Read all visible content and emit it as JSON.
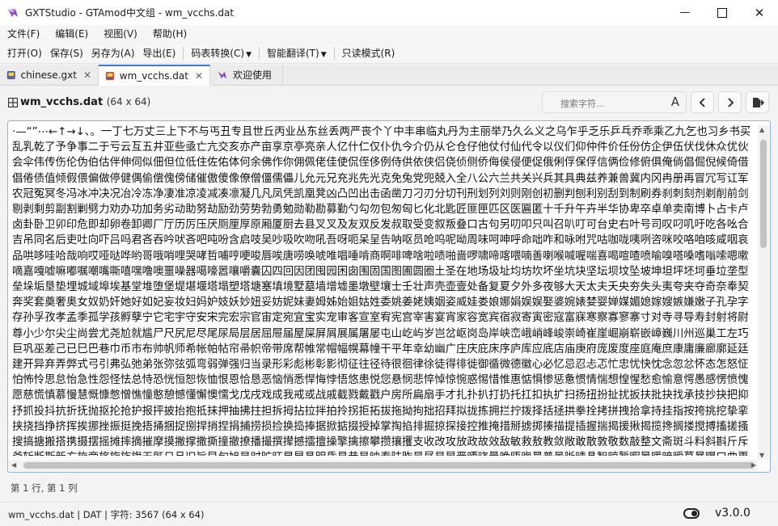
{
  "window": {
    "title": "GXTStudio - GTAmod中文组 - wm_vcchs.dat",
    "minimize_glyph": "—",
    "maximize_glyph": "☐",
    "close_glyph": "✕"
  },
  "menu": [
    "文件(F)",
    "编辑(E)",
    "视图(V)",
    "帮助(H)"
  ],
  "toolbar": {
    "open": "打开(O)",
    "save": "保存(S)",
    "save_as": "另存为(A)",
    "export": "导出(E)",
    "encoding": "码表转换(C)",
    "smart_translate": "智能翻译(T)",
    "readonly": "只读模式(R)"
  },
  "tabs": [
    {
      "label": "chinese.gxt",
      "close": "✕"
    },
    {
      "label": "wm_vcchs.dat",
      "close": "✕"
    },
    {
      "label": "欢迎使用"
    }
  ],
  "file_header": {
    "name": "wm_vcchs.dat",
    "dims": "(64 x 64)"
  },
  "search": {
    "placeholder": "搜索字符...",
    "case_label": "A"
  },
  "editor_text": "·—“”⋯←↑→↓、。一丁七万丈三上下不与丐丑专且世丘丙业丛东丝丢两严丧个丫中丰串临丸丹为主丽举乃久么义之乌乍乎乏乐乒乓乔乖乘乙九乞也习乡书买乱乳乾了予争事二于亏云互五井亚些亟亡亢交亥亦产亩享京亭亮亲人亿什仁仅仆仇今介仍从仑仓仔他仗付仙代令以仪们仰仲件价任份仿企伊伍伏伐休众优伙会伞伟传伤伦伪伯估伴伸伺似佃但位低住佐佑体何余佛作你佣佩佬佳使侃侄侈例侍供依侠侣侥侦侧侨侮侯侵便促俄俐俘保俘信俩俭修俯俱俺倘倡倔倪候倚借倡倦债值倾假偎偏做停健偶偷偿傀傍储催傲傻像僚僧僵儒儡儿允元兄充兆先光克免兔党兜兢入全八公六兰共关兴兵其具典兹养兼兽冀内冈冉册再冒冗写讧军农冠冤冥冬冯冰冲决况冶冷冻净凄准凉凌减凑凛凝几凡凤凭凯凰凳凶凸凹出击函凿刀刁刃分切刊刑划列刘则刚创初删判刨利别刮到制刷券刹刺刻剂剃削前剑剔剥剩剪副割剿劈力劝办功加务劣动助努劫励劲劳势勃勇勉勋勒勘募勤勺勾勿包匆匈匕化北匙匠匪匣匹区医匾匿十千升午卉半华协卑卒卓单卖南博卜占卡卢卤卦卧卫卯印危即却卵卷卸卿厂厅历厉压厌厕厘厚原厢厦厨去县叉叉及友双反发叔取受变叙叛叠口古句另叨叩只叫召叭叮可台史右叶号司叹叼叽吁吃各吆合吉吊同名后吏吐向吓吕吗君吝吞吟吠吝吧吨吩含启吱吴吵吸吹吻吼吾呀呃呆呈告呐呕员呛呜呢呦周味呵呻呼命咄咋和咏咐咒咕咖咙咦咧咨咪咬咯咱咳咸咽哀品哄哆哇哈哉响哎哑哒哗哟哥哦哨哩哭哮哲哺哼哽唆唇唉唐唠唤唬唯唱唾啃商啊啡啤啥啦啧啪啬啰啸啼喀喂喃善喇喉喊喔喘喜喝喧喳喷喻嗅嗒嗓嗜嗡嗦嗯嗽嘀嘉嘎嘘嘛嘟嘱嘲嘴嘶嘻嘿噜噢噩噪器噶嚎嚣嚷嚼囊囚四回因团囤园困囱围固国图圃圆圈土圣在地场圾址均坊坎坏坐坑块坚坛坝坟坠坡坤坦坪坯坷垂垃垄型垒垛垢垦垫埋城域埠埃基堂堆堕堡堤堪堰塔塌塑塔塘塞填境墅墓墙增墟墨墩壁壤士壬壮声壳壶壹处备复夏夕外多夜够大天太夫夭央夯失头夷夸夹夺奇奈奉契奔奖套奠奢奥女奴奶奸她好如妃妄妆妇妈妒妓妖妙妞妥妨妮妹妻姆姊始姐姑姓委姚姜姥姨姻姿威娃娄娘娜娟娱娱娶婆婉婊婪婴婵媒媚媳嫁嫂嫉嫌嫩子孔孕字存孙孚孜孝孟季孤学孩孵孽宁它宅宇守安宋完宏宗官宙定宛宜宝实宠审客宣室宥宪宫宰害宴宵家容宽宾宿寂寄寅密寇富寐寒察寡寥寨寸对寺寻导寿封射将尉尊小少尔尖尘尚尝尤尧尬就尴尸尺尻尼尽尾尿局层居屈屉届屋屎屏屑展属屠屡屯山屹屿岁岂岔岖岗岛岸峡峦峨峭峰峻崇崎崔崖崛崩崭嵌嶂巍川州巡巢工左巧巨巩巫差己已巳巴巷巾币市布帅帆师希帐帕帖帘帚帜帝带席帮帷常帽幅幌幕幢干平年幸幼幽广庄庆庇床序庐库应底店庙庚府庞废度座庭庵庶康庸廉廊廓延廷建开异弃弄弊式弓引弗弘弛弟张弥弦弧弯弱弹强归当录形彩彪彬彰影彻征往径待很徊律徐徒得徘徙御循微德徽心必忆忌忍忐忑忙忠忧快忱念忽忿怀态怎怒怔怕怖怜思怠怡急性怨怪怯总恃恐恍恒恕恢恤恨恩恰恳恶恼悄悉悍悔悖悟悠患悦您悬悯悲悴悼惊惋惑惕惜惟惠惦惧惨惩惫惯情惴想惶惺愁愈愉意愕愚感愣愤愧愿慈慌慎慕慢慧慨慷憋憎憔憧憨憩憾懂懈懊懦戈戊戌戏成我戒或战戚截戮戴戳户房所扁扇手才扎扑扒打扔托扛扣执扩扫扬扭扮扯扰扳扶批抉找承技抄抉把抑抒抓投抖抗折抚抛抠抡抢护报抨披抬抱抵抹押抽拂拄担拆拇拈拉拌拍拎拐拒拓拔拖拗拘拙招拜拟拢拣拥拦拧拨择括拯拱拳拴拷拼拽拾拿持挂指按挎挑挖挚挛挟挠挡挣挤挥挨挪挫振挺挽捂捅捆捉捌捍捎捏捐捕捞损捡换捣捧据掀掂掇授掉掌掏掐排掘掠探接控推掩措掰掳掷揍描提插握揣揭援揪揭揽搀搁搂搅搏搐搓搔搜搞搪搬搭携摄摆摇摊摔摘摧摩摸撇撑撒撕撞撤撩播撮撰撵撼擂擅操擎擒擦攀攒攘攫支收改攻放政故效敌敏救敖教敛敞敢散敦敬数敲整文斋斑斗料斜斟斤斥斧斩断斯新方施旁旅旋族旗无既日旦旧旨早旬旭旱时旷旺昂昆昌明昏易昔星映春昧昨是昼显晃晋晒晓晕晚晤晦晨普景晰晴晶智晾暂暇暑暖暗暧暮暴曝曰曲更曹曼曾替最月有朋服朗望朝期朦木未末本术朱朴朵机杀杂权杆杉李杏材村杖杜束杠条来杨杯杰杳松板极构枉析枕林枚果枝枢枪枫枯架柄柏某柑染柔柜查柬柱柳柴柿栅标栈栋栏树栓栖栗校株样核根格栽桂桃框案桌桑桔档桥桦桨桩桶梁梅梗梦梧梨梭梯械梳检棉棋棍棒棕棘棚棠森棱棵椅植椎椒椭椰楚楞楼概榄榆榔榜榨榴槌槛槽樱樵橄橘橙橡橱檀檐檬欠次欢欣欧欲欺款歇歉歌止正此步武歧歪死殃殊残殒殖殴段殷殿毁毅母每毒比毕毙毛毡毫毯氏民氓气氛氢氧氨氮水永汁求汇汉汗汛汝江池污汤汪汰汹汽沃沈沉沐沙沟没沥沦沫沮河沸油治沼沾沿泄泉泊法泛泡波泣泥注泪泰泳泵泼泽洁洋洒洗洛洞津洪洲活派流浅浆测济浏浑浓浙浦浩浪浮浴海浸涂消涉涌涎涕涛涝涡涣涤润涨涩涯液涵淀淆淋淌淑淘淡淤淫深淳混淹添清渊渍渐渔渗渠渡渣温港渲渴游湃湖湘湾湿溃溅源溜溢溪溶溺滑滓滔滚滞满滤滥滨滩滴漂漆漏漓演漠漩漫漱潇潘潜潭潮澄澈澡激濒瀑灌火灭灯灰灵灶灼灾灿炉炊炎炒炕炫炬炭炮炸点炼炽烁烂烈烘烙烛烟烤烦烧烫热烹焉焊焕焚焦焰然煌煎煞煤照煮熄熊熏熔熙熟熬燃燎燕燥爆爪爬爱爵父爷爸爹爽片版牌牙牛牡牢牧物牲牵特牺犀犁犬犯状犹狂狐狗狙狞狠狡独狭狮狰狱狸狼猎猖猛猜猩猪猫献猴猾猿獗玄率玉王玛玩玫环现玲玷玻珊珍珠班球理琐琢琪琳琴瑕瑞瑟瑰璃瓜瓦瓶瓷甘甚甜生用甩甫田由甲申电男画畅界畏留略番畴疆疏疑疗疙疚疤疫疮疯疲疼疾病症痒痕痛痞痪痰痴瘀瘟瘦瘩瘪瘫瘾癌癖登白百的皆皇皮皱盆盈益盏盐监盒盔盖盗盘盛盟目盯盲直相盹盼盾省眉看真眠眨眩眶眼着睁睐睛睡督睦睬睹瞄瞅瞌瞎瞒瞧瞪瞬瞭瞻矛矢知矩矫短矮石矿码砍研砖砰破砸础硅硕硝硫硬确碌碍碎碑碗碟碧碰碳碴磅磁磕磨磷礁示礼社祈祖祝神祟祥票祸禁福离禽秀私秃秉秋种科秒秘租秤秩积称移稀程稍税稚稠稳稻稼稽稿穆究穷空穿突窃窄窍窑窒窗窜窝窟窥立竖站竞竟章童端竭竹笑笔笛符笨第笼等筋筏筐筑筒答策筹签简箍算管箭箱篇篓篮篷簇簧簸籍米类粉粒粗粘粟粤粥粪粮粹精糊糖糕糙糟糠系紊素索紧紫累絮繁纠红纤约级纪纫纬纯纱纲纳纵纷纸纹纺纽线练组细织终绅绊绍经绑绒结绕绘给络绝绞统绢绣继绩绪续绰绳维绵绷综绽绿缀缄缆缓编缘缚缝缠缤缩缴缸缺罐网罕罗罚罢罩罪置署羊美羞羡群羹羽翁翅翘翠翻翼耀老考者而耍耐耕耗耳耶耸耻耽聊聋职联聘聚聪肃肆肇肉肋肌肖肘肚肝肠股肢肤肥肩肪肯育肺肿胀胁胃胆背胎胖胜胞胡胧胳胶胸能脂脆脉脊脏脑脖脚脱脸腐腔腕腥腰腹腺腻腾腿膀膊膏膛膜膝膨臀臂臭至致舀舅舌舍舒舔舞舟航般舰舱船艇艘良艰色艳艺节芋芒芙芜芝芦芬花芳芹苍苏苔苗苛苟若苦英苹茂范茄茅茉茎茧茫茵茶茸荆草荐荒荡荣荤荧药荷莉莓莫莱莲获莹莺菇菊菌菜菠菱萄萌萎萝营萧萨落著葛葡董葬葱蒂蒋蒙蒜蒲蒸蓄蓝蓬蔑蔓蔗蔚蔬蔼蕉蕴蕾薄薪薯藉藏藤藻蘑虎虏虐虑虚虫虱虹虽虾蚀蚁蚂蚊蛇蛋蛙蛛蛮蛾蜀蜂蜓蜕蜗蜘蜜蜡蝇蝎蝙蝠蝴蝶融螃螺蟹蠢血衅行衍衔街衡衣补表衫衬衰衷袁袋袍袖袜被袭裁裂装裔裕裙裤裳裸裹褐褪襟西要覆见观规视览觉角解触言誉誓警计订认讥讨让训议讯记讲讳讶许论讼设访诀证评诅识诈诉诊词译试诗诚话诞诡询该详诧诫诬语误诱说诵请诸诺读课谁调谅谈谊谋谎谐谓谚谜谢谣谦谨谬谱谴谷豁豆豌豚象豪豹貌贝贞负贡财责贤败账货质贩贪贫购贯贱贴贵贷贸费贺贼贾贿资赋赌赏赐赔赖赚赛赞赠赢赤赦走赴赵赶起趁超越趋趟趣足趴跃跋跌跑距跟跨跪路跳践跺踢踩踪踱踹蹈蹋蹦蹬蹭蹲躁躇躲身躬躺车轨轩转轮软轰轴轻载轿较辅辆辈辉辐辑输辖辛辜辞辟辣辨辩辫辰辱边辽达迁迂迄迅过迈迎运近返还这进远违连迟迪迫述迷迹追退送适逃逆选逊透逐递途逗通逛逝速造逢逮逸逻逼遇遍道遗遣遥遭遮遵避邀邋邑那邦邪邮邻郁郊郎郑部郭都鄙配酒酗酝酣酪酬酱酷酸酿醉醒采释里重野量金鉴针钉钓钙钝钞钟钢钥钦钩钮钱钳钻铁铃铅铜铝铭铲银铸铺链销锁锅锈锋锐错锡锣锤锦锯键锻镀镇镐镜镶长门闪闭问闯闲间闷闸闹闻阁阀阅队阱防阳阴阵阶阻阿陀附际陆陈降限陋陌院除险陪陶陷隆隐隔障隧隶难雀雁雄雅集雇雕雨雪零雷雾需霄震霉霍霓霜霞露霸青静非靠面革靴靶鞋鞍鞭韦韧音韵页顶项顺须顽顾顿预领颈频颓颖颗题颜额颠颤风飘飙飞食餐饥饭饮饰饱饲饶饼饿馆馈馋馒首香马驭驯驰驱驳驶驻驾骂骄骆验骏骑骗骚骤骨髓高鬼魁魂魄魅魔鱼鲁鲜鸟鸡鸣鸦鸭鸽鸿鹅鹊鹰麻黄黎黑默鼓鼠鼻齐齿龙龟",
  "cursor_pos": "第 1 行, 第 1 列",
  "status": {
    "text": "wm_vcchs.dat | DAT | 字符: 3567 (64 x 64)",
    "version": "v3.0.0"
  },
  "colors": {
    "accent": "#3b78d8",
    "app_icon": "#8a3fd0"
  }
}
